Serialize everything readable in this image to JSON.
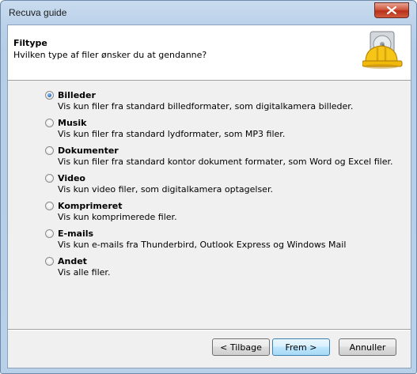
{
  "window": {
    "title": "Recuva guide"
  },
  "header": {
    "title": "Filtype",
    "subtitle": "Hvilken type af filer ønsker du at gendanne?",
    "logo_icon": "recuva-hardhat-drive-icon"
  },
  "options": [
    {
      "label": "Billeder",
      "description": "Vis kun filer fra standard billedformater, som digitalkamera billeder.",
      "checked": true
    },
    {
      "label": "Musik",
      "description": "Vis kun filer fra standard lydformater, som MP3 filer.",
      "checked": false
    },
    {
      "label": "Dokumenter",
      "description": "Vis kun filer fra standard kontor dokument formater, som Word og Excel filer.",
      "checked": false
    },
    {
      "label": "Video",
      "description": "Vis kun video filer, som digitalkamera optagelser.",
      "checked": false
    },
    {
      "label": "Komprimeret",
      "description": "Vis kun komprimerede filer.",
      "checked": false
    },
    {
      "label": "E-mails",
      "description": "Vis kun e-mails fra Thunderbird, Outlook Express og Windows Mail",
      "checked": false
    },
    {
      "label": "Andet",
      "description": "Vis alle filer.",
      "checked": false
    }
  ],
  "buttons": {
    "back": "< Tilbage",
    "next": "Frem >",
    "cancel": "Annuller"
  }
}
